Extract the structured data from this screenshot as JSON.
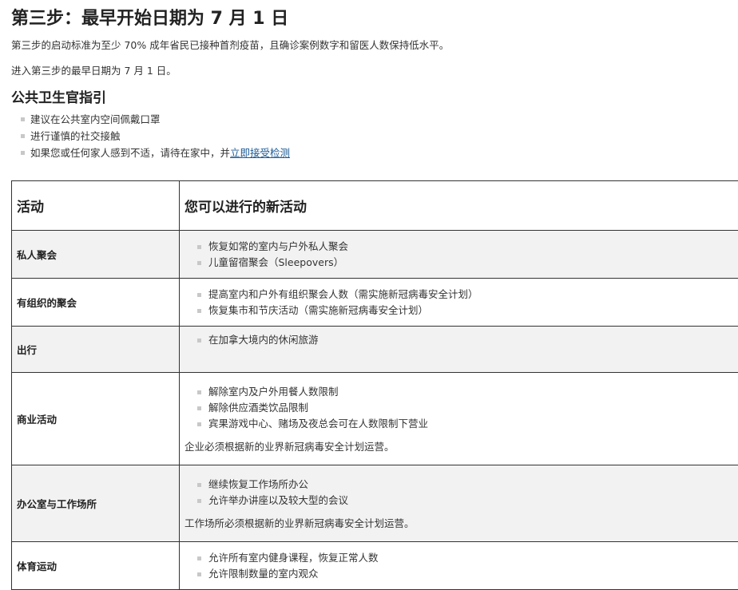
{
  "heading": "第三步：最早开始日期为 7 月 1 日",
  "intro1": "第三步的启动标准为至少 70% 成年省民已接种首剂疫苗，且确诊案例数字和留医人数保持低水平。",
  "intro2": "进入第三步的最早日期为 7 月 1 日。",
  "guidance": {
    "title": "公共卫生官指引",
    "items": [
      "建议在公共室内空间佩戴口罩",
      "进行谨慎的社交接触"
    ],
    "item3_prefix": "如果您或任何家人感到不适，请待在家中，并",
    "item3_link": "立即接受检测"
  },
  "table": {
    "headers": [
      "活动",
      "您可以进行的新活动"
    ],
    "rows": [
      {
        "category": "私人聚会",
        "items": [
          "恢复如常的室内与户外私人聚会",
          "儿童留宿聚会（Sleepovers）"
        ],
        "note": ""
      },
      {
        "category": "有组织的聚会",
        "items": [
          "提高室内和户外有组织聚会人数（需实施新冠病毒安全计划）",
          "恢复集市和节庆活动（需实施新冠病毒安全计划）"
        ],
        "note": ""
      },
      {
        "category": "出行",
        "items": [
          "在加拿大境内的休闲旅游"
        ],
        "note": ""
      },
      {
        "category": "商业活动",
        "items": [
          "解除室内及户外用餐人数限制",
          "解除供应酒类饮品限制",
          "宾果游戏中心、赌场及夜总会可在人数限制下营业"
        ],
        "note": "企业必须根据新的业界新冠病毒安全计划运营。"
      },
      {
        "category": "办公室与工作场所",
        "items": [
          "继续恢复工作场所办公",
          "允许举办讲座以及较大型的会议"
        ],
        "note": "工作场所必须根据新的业界新冠病毒安全计划运营。"
      },
      {
        "category": "体育运动",
        "items": [
          "允许所有室内健身课程，恢复正常人数",
          "允许限制数量的室内观众"
        ],
        "note": ""
      }
    ]
  }
}
